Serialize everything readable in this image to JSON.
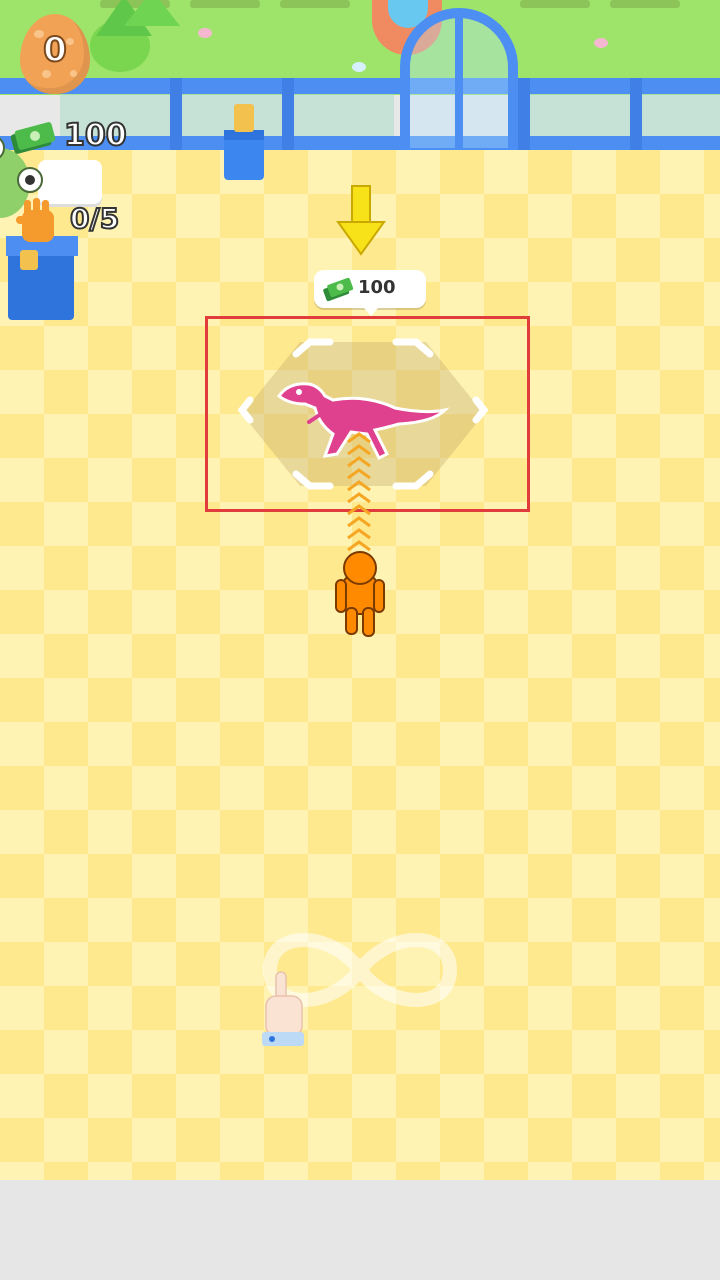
{
  "hud": {
    "egg_count": "0",
    "money": "100",
    "carry_capacity": "0/5"
  },
  "unlock_zone": {
    "price": "100",
    "creature": "raptor"
  },
  "icons": {
    "egg": "egg-icon",
    "money": "money-icon",
    "hand": "hand-icon",
    "arrow": "down-arrow-icon",
    "tutorial": "infinity-swipe-icon"
  },
  "colors": {
    "floor_light": "#fff3b4",
    "floor_dark": "#ffe98e",
    "fence": "#4c8ef2",
    "highlight": "#e03c3c",
    "player": "#ff8a00",
    "dino": "#e0418f"
  }
}
